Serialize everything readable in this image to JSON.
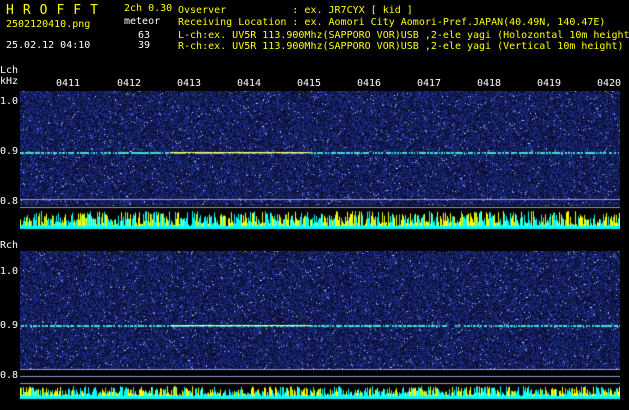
{
  "header": {
    "app_title": "HROFFT",
    "version": "2ch 0.30",
    "filename": "2502120410.png",
    "meteor_label": "meteor",
    "date": "25.02.12 04:10",
    "l_count": "63",
    "r_count": "39"
  },
  "info_lines": [
    "Ovserver           : ex. JR7CYX [ kid ]",
    "Receiving Location : ex. Aomori City Aomori-Pref.JAPAN(40.49N, 140.47E)",
    "L-ch:ex. UV5R 113.900Mhz(SAPPORO VOR)USB ,2-ele yagi (Holozontal 10m height",
    "R-ch:ex. UV5R 113.900Mhz(SAPPORO VOR)USB ,2-ele yagi (Vertical 10m height)"
  ],
  "labels": {
    "lch": "Lch",
    "khz": "kHz",
    "rch": "Rch"
  },
  "time_ticks": [
    "0411",
    "0412",
    "0413",
    "0414",
    "0415",
    "0416",
    "0417",
    "0418",
    "0419",
    "0420"
  ],
  "freq_ticks": [
    "1.0",
    "0.9",
    "0.8"
  ],
  "colors": {
    "header_yellow": "#ffff00",
    "background": "#000000",
    "noise_blue": "#1e2a8a",
    "signal_line": "#40e0d0",
    "activity_yellow": "#ffff00",
    "activity_cyan": "#00ffff"
  }
}
